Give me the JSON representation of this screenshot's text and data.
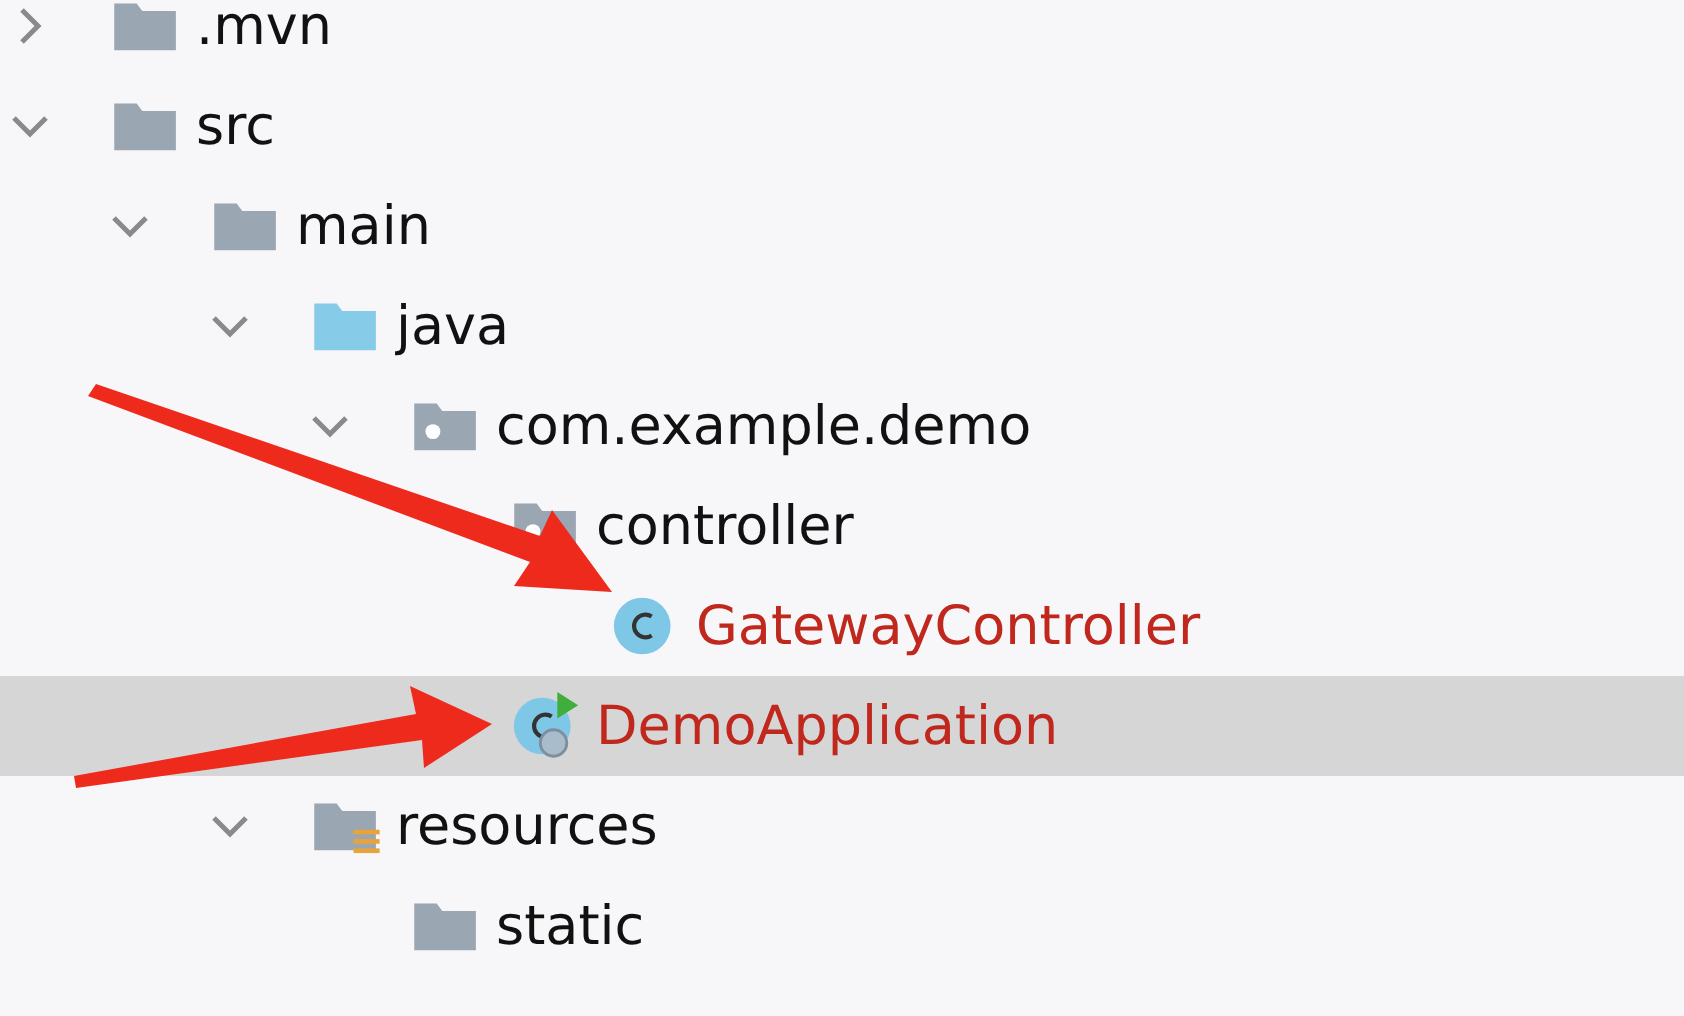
{
  "tree": [
    {
      "label": ".mvn",
      "kind": "folder",
      "expanded": false,
      "selected": false
    },
    {
      "label": "src",
      "kind": "folder",
      "expanded": true,
      "selected": false,
      "children": [
        {
          "label": "main",
          "kind": "folder",
          "expanded": true,
          "selected": false,
          "children": [
            {
              "label": "java",
              "kind": "source-folder",
              "expanded": true,
              "selected": false,
              "children": [
                {
                  "label": "com.example.demo",
                  "kind": "package",
                  "expanded": true,
                  "selected": false,
                  "children": [
                    {
                      "label": "controller",
                      "kind": "package",
                      "selected": false,
                      "children": [
                        {
                          "label": "GatewayController",
                          "kind": "class",
                          "color": "#c0281e",
                          "selected": false
                        }
                      ]
                    },
                    {
                      "label": "DemoApplication",
                      "kind": "app-class",
                      "color": "#c0281e",
                      "selected": true
                    }
                  ]
                }
              ]
            },
            {
              "label": "resources",
              "kind": "resources-folder",
              "expanded": true,
              "selected": false,
              "children": [
                {
                  "label": "static",
                  "kind": "folder",
                  "selected": false
                }
              ]
            }
          ]
        }
      ]
    }
  ]
}
